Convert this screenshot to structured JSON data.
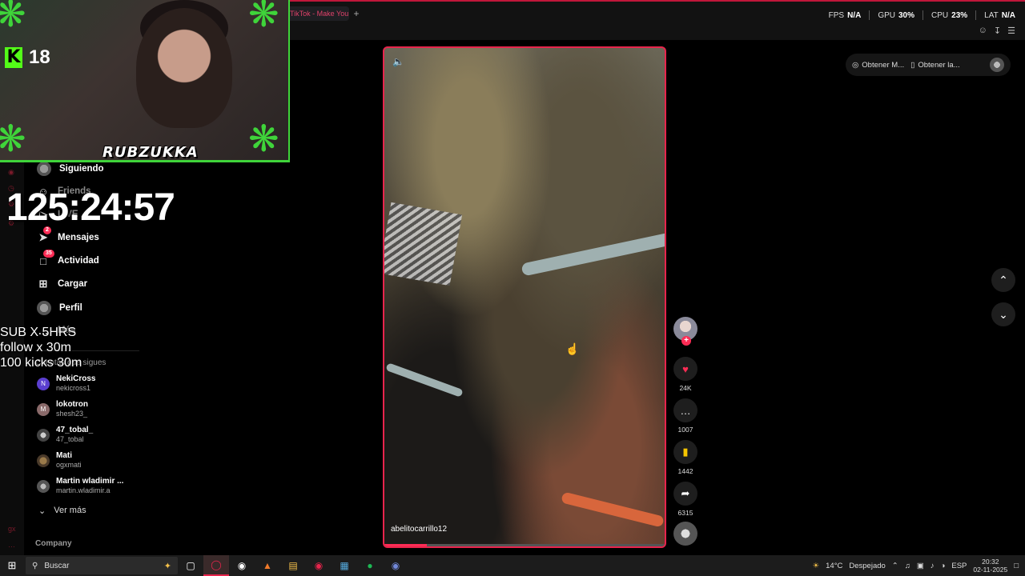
{
  "browser": {
    "tab_title": "TikTok - Make You",
    "new_tab": "+",
    "stats": [
      {
        "label": "FPS",
        "value": "N/A"
      },
      {
        "label": "GPU",
        "value": "30%"
      },
      {
        "label": "CPU",
        "value": "23%"
      },
      {
        "label": "LAT",
        "value": "N/A"
      }
    ],
    "toolbar_icons": [
      "profile-icon",
      "download-icon",
      "menu-icon"
    ]
  },
  "stream_overlay": {
    "kick_logo": "K",
    "viewer_count": "18",
    "streamer_name": "RUBZUKKA",
    "timer": "125:24:57",
    "sub_lines": [
      "SUB X 5HRS",
      "follow x 30m",
      "100 kicks 30m"
    ]
  },
  "sidebar": {
    "nav": [
      {
        "label": "Siguiendo",
        "icon": "avatar-icon"
      },
      {
        "label": "Friends",
        "icon": "friends-icon"
      },
      {
        "label": "LIVE",
        "icon": "live-icon"
      },
      {
        "label": "Mensajes",
        "icon": "messages-icon",
        "badge": "2"
      },
      {
        "label": "Actividad",
        "icon": "activity-icon",
        "badge": "35"
      },
      {
        "label": "Cargar",
        "icon": "upload-icon"
      },
      {
        "label": "Perfil",
        "icon": "profile-avatar-icon"
      },
      {
        "label": "Más",
        "icon": "more-icon"
      }
    ],
    "following_header": "Cuentas que sigues",
    "following": [
      {
        "name": "NekiCross",
        "handle": "nekicross1",
        "initial": "N",
        "color": "#5b3fd0"
      },
      {
        "name": "lokotron",
        "handle": "shesh23_",
        "initial": "M",
        "color": "#8a6a6a"
      },
      {
        "name": "47_tobal_",
        "handle": "47_tobal",
        "initial": "",
        "color": "#666666"
      },
      {
        "name": "Mati",
        "handle": "ogxmati",
        "initial": "",
        "color": "#7a5a3a"
      },
      {
        "name": "Martin wladimir ...",
        "handle": "martin.wladimir.a",
        "initial": "",
        "color": "#777777"
      }
    ],
    "see_more": "Ver más",
    "company": "Company"
  },
  "video": {
    "author": "abelitocarrillo12",
    "progress": 0.15
  },
  "actions": {
    "likes": "24K",
    "comments": "1007",
    "saves": "1442",
    "shares": "6315"
  },
  "top_pill": {
    "item1": "Obtener M...",
    "item2": "Obtener la..."
  },
  "taskbar": {
    "search_placeholder": "Buscar",
    "weather_temp": "14°C",
    "weather_desc": "Despejado",
    "language": "ESP",
    "time": "20:32",
    "date": "02-11-2025"
  }
}
